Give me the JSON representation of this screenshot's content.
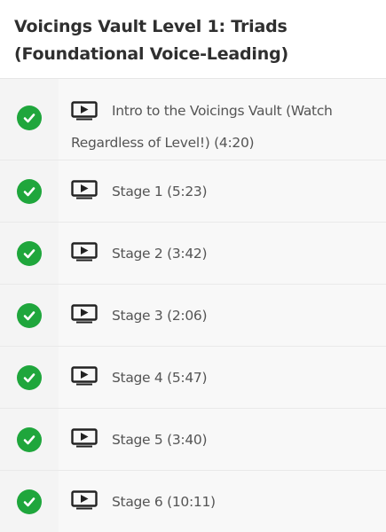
{
  "section": {
    "title": "Voicings Vault Level 1: Triads (Foundational Voice-Leading)"
  },
  "lectures": [
    {
      "status": "complete",
      "icon": "video-icon",
      "name": "Intro to the Voicings Vault (Watch Regardless of Level!) (4:20)"
    },
    {
      "status": "complete",
      "icon": "video-icon",
      "name": "Stage 1 (5:23)"
    },
    {
      "status": "complete",
      "icon": "video-icon",
      "name": "Stage 2 (3:42)"
    },
    {
      "status": "complete",
      "icon": "video-icon",
      "name": "Stage 3 (2:06)"
    },
    {
      "status": "complete",
      "icon": "video-icon",
      "name": "Stage 4 (5:47)"
    },
    {
      "status": "complete",
      "icon": "video-icon",
      "name": "Stage 5 (3:40)"
    },
    {
      "status": "complete",
      "icon": "video-icon",
      "name": "Stage 6 (10:11)"
    }
  ],
  "colors": {
    "check": "#1fa63c",
    "title": "#2f2f2f",
    "text": "#555555"
  }
}
